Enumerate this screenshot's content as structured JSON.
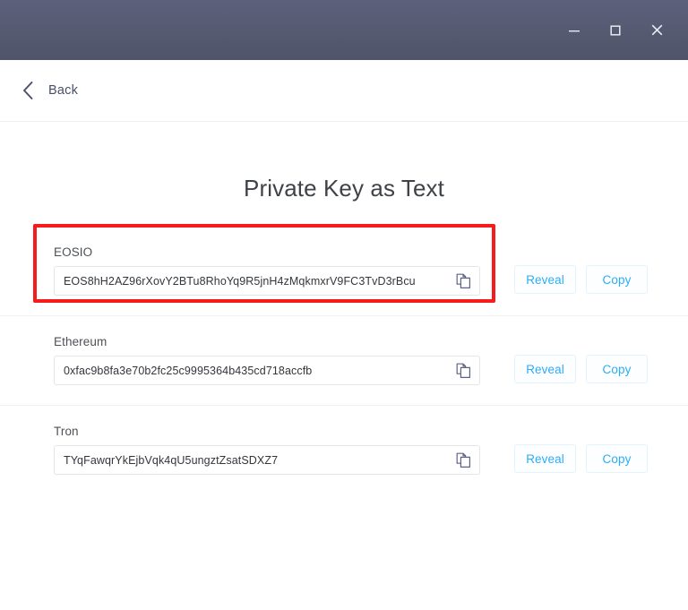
{
  "titlebar": {
    "minimize_label": "Minimize",
    "maximize_label": "Maximize",
    "close_label": "Close",
    "background_color": "#565a73"
  },
  "header": {
    "back_label": "Back",
    "back_icon": "chevron-left-icon"
  },
  "main": {
    "title": "Private Key as Text",
    "reveal_label": "Reveal",
    "copy_label": "Copy",
    "copy_icon": "copy-icon",
    "accent_color": "#2badf5",
    "rows": [
      {
        "label": "EOSIO",
        "value": "EOS8hH2AZ96rXovY2BTu8RhoYq9R5jnH4zMqkmxrV9FC3TvD3rBcu",
        "highlighted": true
      },
      {
        "label": "Ethereum",
        "value": "0xfac9b8fa3e70b2fc25c9995364b435cd718accfb",
        "highlighted": false
      },
      {
        "label": "Tron",
        "value": "TYqFawqrYkEjbVqk4qU5ungztZsatSDXZ7",
        "highlighted": false
      }
    ]
  },
  "annotation": {
    "highlight_color": "#f81b1b"
  }
}
